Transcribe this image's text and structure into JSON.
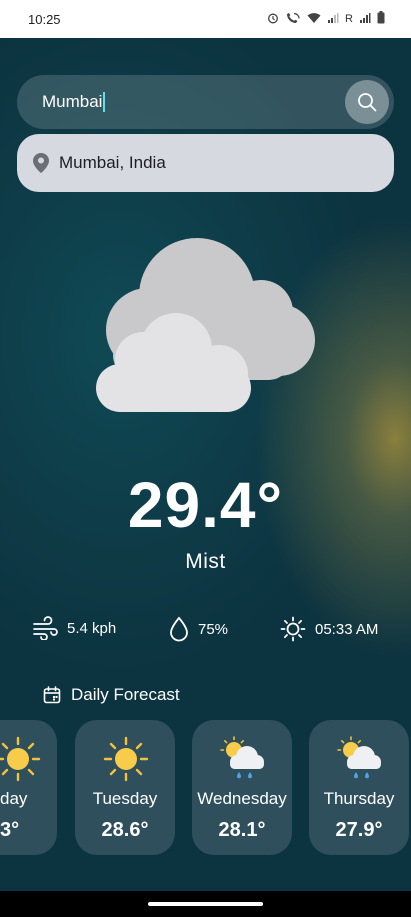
{
  "status_bar": {
    "time": "10:25",
    "icons": [
      "alarm-icon",
      "wifi-call-icon",
      "wifi-icon",
      "signal-icon",
      "roaming-r",
      "signal-icon-2",
      "battery-icon"
    ],
    "roaming_label": "R"
  },
  "search": {
    "value": "Mumbai",
    "suggestion": "Mumbai, India"
  },
  "current": {
    "temperature": "29.4°",
    "condition": "Mist",
    "wind": "5.4 kph",
    "humidity": "75%",
    "sunrise": "05:33 AM"
  },
  "forecast": {
    "title": "Daily Forecast",
    "days": [
      {
        "day": "day",
        "temp": "3°",
        "icon": "sun-icon"
      },
      {
        "day": "Tuesday",
        "temp": "28.6°",
        "icon": "sun-icon"
      },
      {
        "day": "Wednesday",
        "temp": "28.1°",
        "icon": "sun-cloud-rain-icon"
      },
      {
        "day": "Thursday",
        "temp": "27.9°",
        "icon": "sun-cloud-rain-icon"
      }
    ]
  },
  "colors": {
    "background_dark": "#0c3340",
    "background_glow": "#a08c3c",
    "suggestion_bg": "#d6d9e0",
    "caret": "#5fe0e8"
  }
}
